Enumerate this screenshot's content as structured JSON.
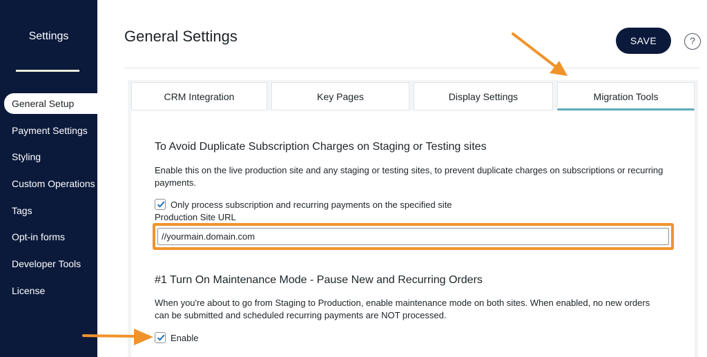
{
  "sidebar": {
    "title": "Settings",
    "items": [
      {
        "label": "General Setup",
        "active": true
      },
      {
        "label": "Payment Settings",
        "active": false
      },
      {
        "label": "Styling",
        "active": false
      },
      {
        "label": "Custom Operations",
        "active": false
      },
      {
        "label": "Tags",
        "active": false
      },
      {
        "label": "Opt-in forms",
        "active": false
      },
      {
        "label": "Developer Tools",
        "active": false
      },
      {
        "label": "License",
        "active": false
      }
    ]
  },
  "header": {
    "title": "General Settings",
    "save_label": "SAVE",
    "help_label": "?"
  },
  "tabs": [
    {
      "label": "CRM Integration",
      "active": false
    },
    {
      "label": "Key Pages",
      "active": false
    },
    {
      "label": "Display Settings",
      "active": false
    },
    {
      "label": "Migration Tools",
      "active": true
    }
  ],
  "section1": {
    "title": "To Avoid Duplicate Subscription Charges on Staging or Testing sites",
    "description": "Enable this on the live production site and any staging or testing sites, to prevent duplicate charges on subscriptions or recurring payments.",
    "checkbox_label": "Only process subscription and recurring payments on the specified site",
    "checkbox_checked": true,
    "field_label": "Production Site URL",
    "field_value": "//yourmain.domain.com"
  },
  "section2": {
    "title": "#1 Turn On Maintenance Mode - Pause New and Recurring Orders",
    "description": "When you're about to go from Staging to Production, enable maintenance mode on both sites. When enabled, no new orders can be submitted and scheduled recurring payments are NOT processed.",
    "checkbox_label": "Enable",
    "checkbox_checked": true
  },
  "colors": {
    "sidebar_bg": "#0b1a3b",
    "accent_highlight": "#f0932b",
    "tab_active_underline": "#5ea9b9",
    "checkmark": "#2271b1"
  }
}
